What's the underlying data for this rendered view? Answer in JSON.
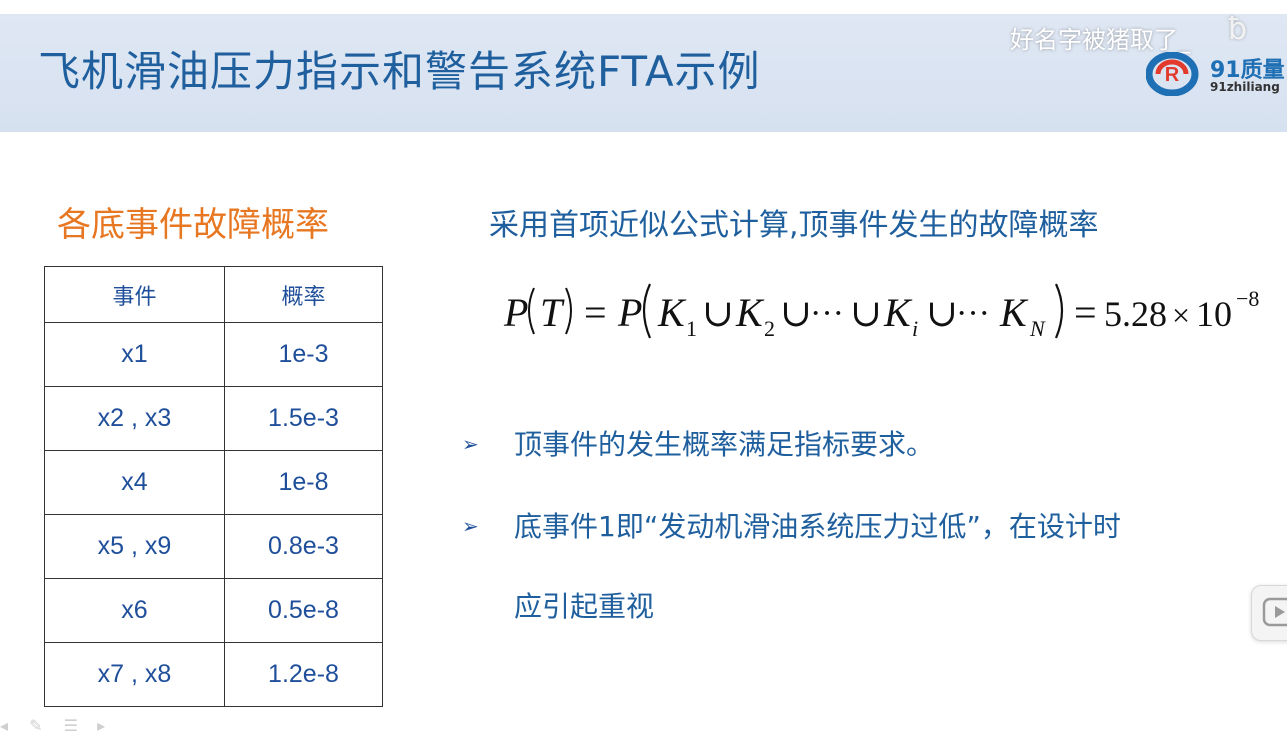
{
  "slide": {
    "title": "飞机滑油压力指示和警告系统FTA示例",
    "watermark": "好名字被猪取了_",
    "logo": {
      "number": "91质量",
      "sub": "91zhiliang"
    },
    "left_heading": "各底事件故障概率",
    "table": {
      "headers": [
        "事件",
        "概率"
      ],
      "rows": [
        [
          "x1",
          "1e-3"
        ],
        [
          "x2 , x3",
          "1.5e-3"
        ],
        [
          "x4",
          "1e-8"
        ],
        [
          "x5 , x9",
          "0.8e-3"
        ],
        [
          "x6",
          "0.5e-8"
        ],
        [
          "x7 , x8",
          "1.2e-8"
        ]
      ]
    },
    "right_heading": "采用首项近似公式计算,顶事件发生的故障概率",
    "formula": {
      "P": "P",
      "T": "T",
      "eq": "=",
      "K": "K",
      "sub1": "1",
      "sub2": "2",
      "subi": "i",
      "subN": "N",
      "cup": "∪",
      "dots": "···",
      "value": "5.28",
      "times": "×",
      "base": "10",
      "exp": "−8"
    },
    "bullets": [
      {
        "marker": "➢",
        "line1": "顶事件的发生概率满足指标要求。",
        "line2": ""
      },
      {
        "marker": "➢",
        "line1": "底事件1即“发动机滑油系统压力过低”，在设计时",
        "line2": "应引起重视"
      }
    ]
  },
  "colors": {
    "title": "#1f5f9e",
    "heading_orange": "#e87722",
    "table_text": "#1f4f9a",
    "band": "#dbe4f2"
  }
}
